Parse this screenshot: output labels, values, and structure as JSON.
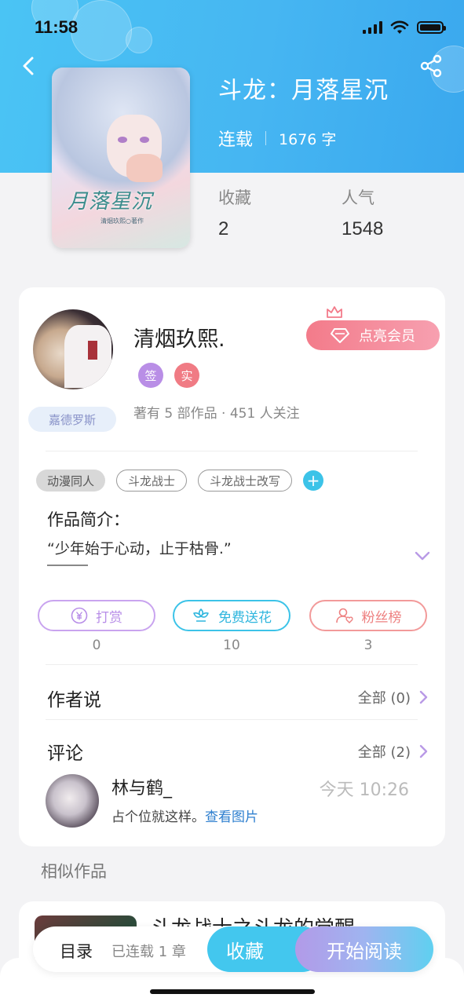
{
  "status_bar": {
    "time": "11:58"
  },
  "book": {
    "title": "斗龙：月落星沉",
    "status": "连载",
    "word_count": "1676 字",
    "cover_title": "月落星沉",
    "cover_author": "清烟玖熙○著作",
    "stats": [
      {
        "label": "收藏",
        "value": "2"
      },
      {
        "label": "人气",
        "value": "1548"
      }
    ]
  },
  "author": {
    "name": "清烟玖熙.",
    "badges": [
      {
        "text": "签",
        "color": "#b98ee6"
      },
      {
        "text": "实",
        "color": "#f07b84"
      }
    ],
    "vip_button": "点亮会员",
    "tag": "嘉德罗斯",
    "stats": "著有 5 部作品 · 451 人关注"
  },
  "tags": [
    "动漫同人",
    "斗龙战士",
    "斗龙战士改写"
  ],
  "intro": {
    "title": "作品简介：",
    "text": "“少年始于心动，止于枯骨.”"
  },
  "actions": [
    {
      "label": "打赏",
      "count": "0",
      "color": "#c08fe6",
      "icon": "yen-icon"
    },
    {
      "label": "免费送花",
      "count": "10",
      "color": "#3cc3e8",
      "icon": "flower-icon"
    },
    {
      "label": "粉丝榜",
      "count": "3",
      "color": "#f08a8a",
      "icon": "fan-icon"
    }
  ],
  "author_says": {
    "title": "作者说",
    "all": "全部 (0)"
  },
  "comments": {
    "title": "评论",
    "all": "全部 (2)",
    "items": [
      {
        "user": "林与鹤_",
        "time": "今天 10:26",
        "text": "占个位就这样。",
        "link": "查看图片"
      }
    ]
  },
  "similar": {
    "title": "相似作品",
    "first_book_title": "斗龙战士之斗龙的觉醒"
  },
  "bottom_bar": {
    "toc": "目录",
    "toc_sub": "已连载 1 章",
    "favorite": "收藏",
    "read": "开始阅读"
  },
  "colors": {
    "header": "#46b6f2",
    "accent": "#3cc3e8",
    "vip": "#f37b8a"
  }
}
